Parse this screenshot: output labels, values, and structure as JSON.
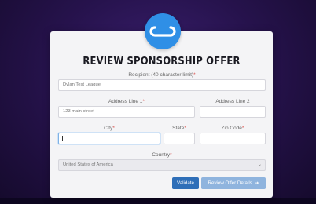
{
  "header": {
    "title": "REVIEW SPONSORSHIP OFFER",
    "logo_icon": "link-logo-icon"
  },
  "recipient": {
    "label": "Recipient (40 character limit)",
    "required_mark": "*",
    "value": "Dylan Test League"
  },
  "address1": {
    "label": "Address Line 1",
    "required_mark": "*",
    "value": "123 main street"
  },
  "address2": {
    "label": "Address Line 2",
    "value": ""
  },
  "city": {
    "label": "City",
    "required_mark": "*",
    "value": ""
  },
  "state": {
    "label": "State",
    "required_mark": "*",
    "value": ""
  },
  "zip": {
    "label": "Zip Code",
    "required_mark": "*",
    "value": ""
  },
  "country": {
    "label": "Country",
    "required_mark": "*",
    "selected": "United States of America"
  },
  "actions": {
    "validate_label": "Validate",
    "review_label": "Review Offer Details",
    "review_icon": "arrow-right-icon"
  },
  "colors": {
    "accent": "#2f8fe6",
    "validate_button": "#2f6fb8",
    "review_button": "#8fb4de",
    "required": "#d9534f"
  }
}
